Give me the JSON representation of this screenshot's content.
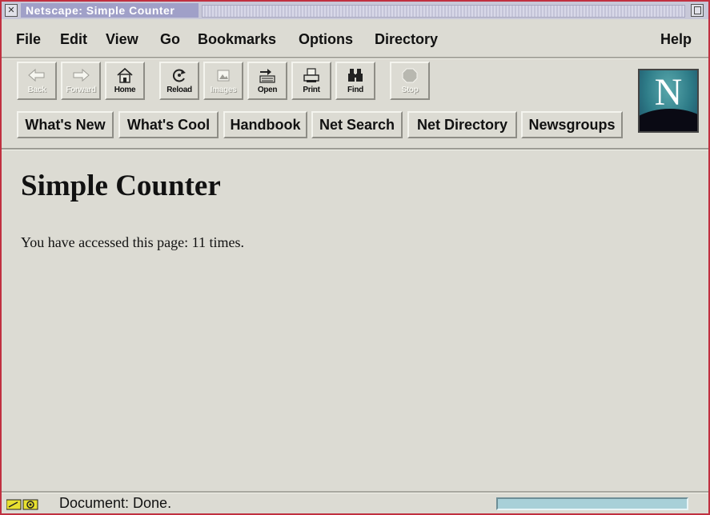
{
  "window": {
    "title": "Netscape: Simple Counter"
  },
  "menu": {
    "items": [
      {
        "label": "File"
      },
      {
        "label": "Edit"
      },
      {
        "label": "View"
      },
      {
        "label": "Go"
      },
      {
        "label": "Bookmarks"
      },
      {
        "label": "Options"
      },
      {
        "label": "Directory"
      },
      {
        "label": "Help"
      }
    ]
  },
  "toolbar": {
    "buttons": [
      {
        "label": "Back",
        "icon": "back-arrow-icon",
        "enabled": false
      },
      {
        "label": "Forward",
        "icon": "forward-arrow-icon",
        "enabled": false
      },
      {
        "label": "Home",
        "icon": "home-icon",
        "enabled": true
      },
      {
        "label": "Reload",
        "icon": "reload-icon",
        "enabled": true
      },
      {
        "label": "Images",
        "icon": "images-icon",
        "enabled": false
      },
      {
        "label": "Open",
        "icon": "open-icon",
        "enabled": true
      },
      {
        "label": "Print",
        "icon": "print-icon",
        "enabled": true
      },
      {
        "label": "Find",
        "icon": "find-binoculars-icon",
        "enabled": true
      },
      {
        "label": "Stop",
        "icon": "stop-icon",
        "enabled": false
      }
    ]
  },
  "directory_buttons": [
    {
      "label": "What's New"
    },
    {
      "label": "What's Cool"
    },
    {
      "label": "Handbook"
    },
    {
      "label": "Net Search"
    },
    {
      "label": "Net Directory"
    },
    {
      "label": "Newsgroups"
    }
  ],
  "logo": {
    "letter": "N"
  },
  "page": {
    "heading": "Simple Counter",
    "body": "You have accessed this page: 11 times."
  },
  "status": {
    "text": "Document: Done.",
    "progress": 1.0
  },
  "colors": {
    "chrome": "#dcdbd3",
    "window_border": "#c03040",
    "progress": "#a8d0d8",
    "logo": "#2e7c88"
  }
}
